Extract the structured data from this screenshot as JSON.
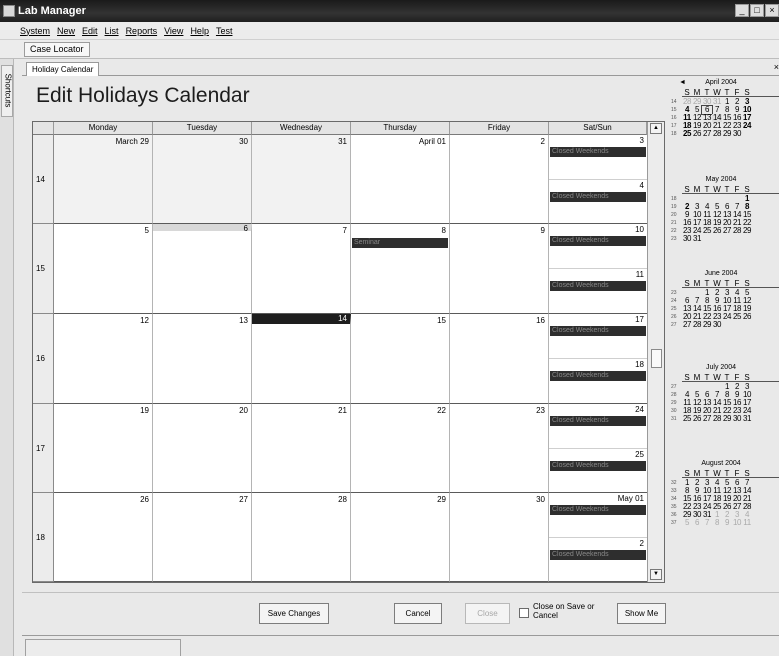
{
  "app": {
    "title": "Lab Manager",
    "win_min": "_",
    "win_max": "□",
    "win_close": "×"
  },
  "menu": [
    "System",
    "New",
    "Edit",
    "List",
    "Reports",
    "View",
    "Help",
    "Test"
  ],
  "toolbar": {
    "case_locator": "Case Locator"
  },
  "sidebar": {
    "shortcuts": "Shortcuts"
  },
  "tab": {
    "label": "Holiday Calendar",
    "close": "×"
  },
  "page": {
    "title": "Edit Holidays Calendar"
  },
  "calendar": {
    "headers": [
      "Monday",
      "Tuesday",
      "Wednesday",
      "Thursday",
      "Friday",
      "Sat/Sun"
    ],
    "weeks": [
      {
        "wk": "14",
        "days": [
          "March 29",
          "30",
          "31",
          "April 01",
          "2"
        ],
        "sat": "3",
        "sun": "4"
      },
      {
        "wk": "15",
        "days": [
          "5",
          "6",
          "7",
          "8",
          "9"
        ],
        "sat": "10",
        "sun": "11"
      },
      {
        "wk": "16",
        "days": [
          "12",
          "13",
          "14",
          "15",
          "16"
        ],
        "sat": "17",
        "sun": "18"
      },
      {
        "wk": "17",
        "days": [
          "19",
          "20",
          "21",
          "22",
          "23"
        ],
        "sat": "24",
        "sun": "25"
      },
      {
        "wk": "18",
        "days": [
          "26",
          "27",
          "28",
          "29",
          "30"
        ],
        "sat": "May 01",
        "sun": "2"
      }
    ],
    "weekend_event": "Closed Weekends",
    "seminar_event": "Seminar"
  },
  "mini": {
    "prev": "◄",
    "next": "►",
    "months": [
      {
        "title": "April 2004",
        "rows": [
          {
            "wk": "14",
            "d": [
              "28",
              "29",
              "30",
              "31",
              "1",
              "2",
              "3"
            ]
          },
          {
            "wk": "15",
            "d": [
              "4",
              "5",
              "6",
              "7",
              "8",
              "9",
              "10"
            ]
          },
          {
            "wk": "16",
            "d": [
              "11",
              "12",
              "13",
              "14",
              "15",
              "16",
              "17"
            ]
          },
          {
            "wk": "17",
            "d": [
              "18",
              "19",
              "20",
              "21",
              "22",
              "23",
              "24"
            ]
          },
          {
            "wk": "18",
            "d": [
              "25",
              "26",
              "27",
              "28",
              "29",
              "30",
              ""
            ]
          }
        ]
      },
      {
        "title": "May 2004",
        "rows": [
          {
            "wk": "18",
            "d": [
              "",
              "",
              "",
              "",
              "",
              "",
              "1"
            ]
          },
          {
            "wk": "19",
            "d": [
              "2",
              "3",
              "4",
              "5",
              "6",
              "7",
              "8"
            ]
          },
          {
            "wk": "20",
            "d": [
              "9",
              "10",
              "11",
              "12",
              "13",
              "14",
              "15"
            ]
          },
          {
            "wk": "21",
            "d": [
              "16",
              "17",
              "18",
              "19",
              "20",
              "21",
              "22"
            ]
          },
          {
            "wk": "22",
            "d": [
              "23",
              "24",
              "25",
              "26",
              "27",
              "28",
              "29"
            ]
          },
          {
            "wk": "23",
            "d": [
              "30",
              "31",
              "",
              "",
              "",
              "",
              ""
            ]
          }
        ]
      },
      {
        "title": "June 2004",
        "rows": [
          {
            "wk": "23",
            "d": [
              "",
              "",
              "1",
              "2",
              "3",
              "4",
              "5"
            ]
          },
          {
            "wk": "24",
            "d": [
              "6",
              "7",
              "8",
              "9",
              "10",
              "11",
              "12"
            ]
          },
          {
            "wk": "25",
            "d": [
              "13",
              "14",
              "15",
              "16",
              "17",
              "18",
              "19"
            ]
          },
          {
            "wk": "26",
            "d": [
              "20",
              "21",
              "22",
              "23",
              "24",
              "25",
              "26"
            ]
          },
          {
            "wk": "27",
            "d": [
              "27",
              "28",
              "29",
              "30",
              "",
              "",
              ""
            ]
          }
        ]
      },
      {
        "title": "July 2004",
        "rows": [
          {
            "wk": "27",
            "d": [
              "",
              "",
              "",
              "",
              "1",
              "2",
              "3"
            ]
          },
          {
            "wk": "28",
            "d": [
              "4",
              "5",
              "6",
              "7",
              "8",
              "9",
              "10"
            ]
          },
          {
            "wk": "29",
            "d": [
              "11",
              "12",
              "13",
              "14",
              "15",
              "16",
              "17"
            ]
          },
          {
            "wk": "30",
            "d": [
              "18",
              "19",
              "20",
              "21",
              "22",
              "23",
              "24"
            ]
          },
          {
            "wk": "31",
            "d": [
              "25",
              "26",
              "27",
              "28",
              "29",
              "30",
              "31"
            ]
          }
        ]
      },
      {
        "title": "August 2004",
        "rows": [
          {
            "wk": "32",
            "d": [
              "1",
              "2",
              "3",
              "4",
              "5",
              "6",
              "7"
            ]
          },
          {
            "wk": "33",
            "d": [
              "8",
              "9",
              "10",
              "11",
              "12",
              "13",
              "14"
            ]
          },
          {
            "wk": "34",
            "d": [
              "15",
              "16",
              "17",
              "18",
              "19",
              "20",
              "21"
            ]
          },
          {
            "wk": "35",
            "d": [
              "22",
              "23",
              "24",
              "25",
              "26",
              "27",
              "28"
            ]
          },
          {
            "wk": "36",
            "d": [
              "29",
              "30",
              "31",
              "1",
              "2",
              "3",
              "4"
            ]
          },
          {
            "wk": "37",
            "d": [
              "5",
              "6",
              "7",
              "8",
              "9",
              "10",
              "11"
            ]
          }
        ]
      }
    ]
  },
  "buttons": {
    "save": "Save Changes",
    "cancel": "Cancel",
    "close": "Close",
    "close_on_save": "Close on Save or Cancel",
    "show_me": "Show Me"
  },
  "colors": {
    "event_bg": "#2e2e2e",
    "today_bar": "#1e1e1e",
    "header_bg": "#e4e4e4"
  }
}
